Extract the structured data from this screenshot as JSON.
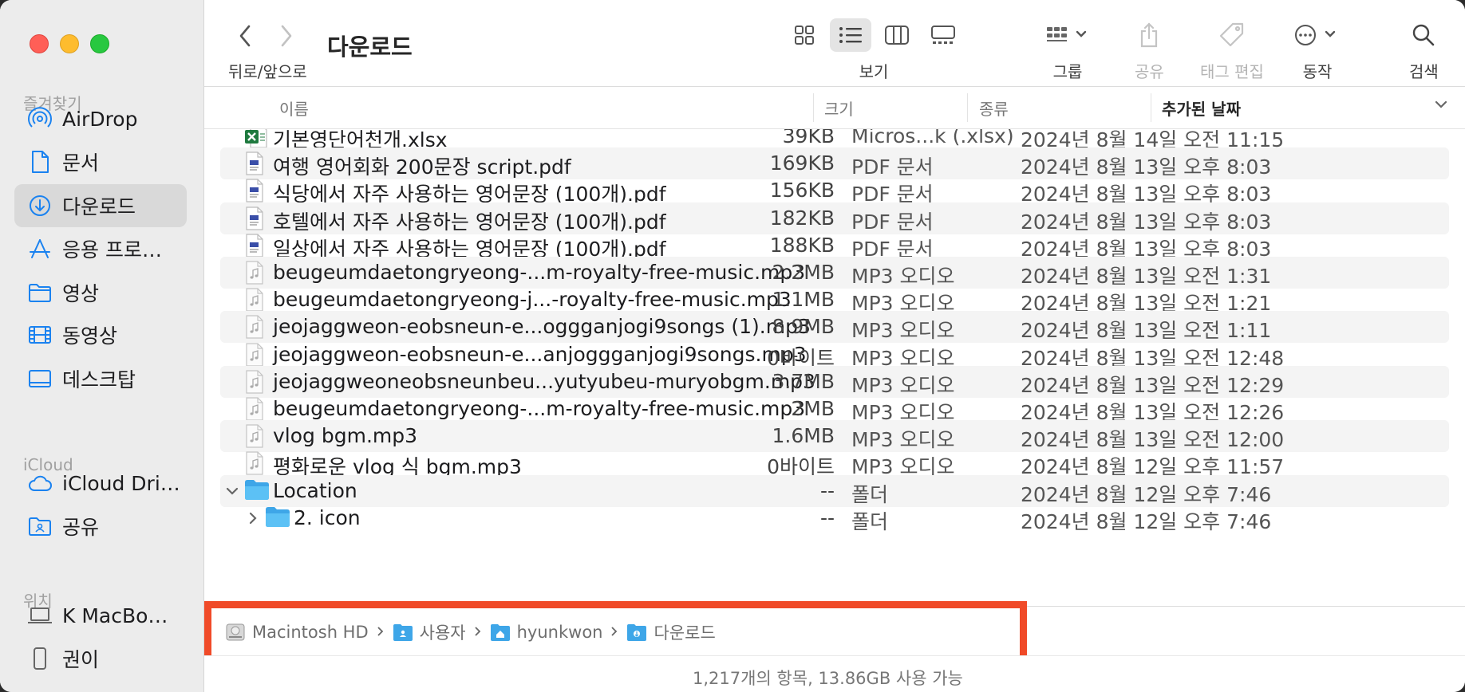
{
  "window": {
    "title": "다운로드"
  },
  "toolbar": {
    "nav_label": "뒤로/앞으로",
    "view_label": "보기",
    "group_label": "그룹",
    "share_label": "공유",
    "tag_label": "태그 편집",
    "action_label": "동작",
    "search_label": "검색"
  },
  "sidebar": {
    "favorites_header": "즐겨찾기",
    "favorites": [
      {
        "label": "AirDrop",
        "icon": "airdrop-icon"
      },
      {
        "label": "문서",
        "icon": "document-icon"
      },
      {
        "label": "다운로드",
        "icon": "download-icon",
        "active": true
      },
      {
        "label": "응용 프로…",
        "icon": "applications-icon"
      },
      {
        "label": "영상",
        "icon": "folder-icon"
      },
      {
        "label": "동영상",
        "icon": "film-icon"
      },
      {
        "label": "데스크탑",
        "icon": "desktop-icon"
      }
    ],
    "icloud_header": "iCloud",
    "icloud": [
      {
        "label": "iCloud Dri…",
        "icon": "cloud-icon"
      },
      {
        "label": "공유",
        "icon": "shared-folder-icon"
      }
    ],
    "locations_header": "위치",
    "locations": [
      {
        "label": "K MacBo…",
        "icon": "laptop-icon"
      },
      {
        "label": "권이",
        "icon": "phone-icon"
      }
    ]
  },
  "columns": {
    "name": "이름",
    "size": "크기",
    "kind": "종류",
    "date_added": "추가된 날짜"
  },
  "files": [
    {
      "name": "기본영단어천개.xlsx",
      "size": "39KB",
      "kind": "Micros...k (.xlsx)",
      "date": "2024년 8월 14일 오전 11:15",
      "type": "xlsx"
    },
    {
      "name": "여행 영어회화 200문장 script.pdf",
      "size": "169KB",
      "kind": "PDF 문서",
      "date": "2024년 8월 13일 오후 8:03",
      "type": "pdf"
    },
    {
      "name": "식당에서 자주 사용하는 영어문장 (100개).pdf",
      "size": "156KB",
      "kind": "PDF 문서",
      "date": "2024년 8월 13일 오후 8:03",
      "type": "pdf"
    },
    {
      "name": "호텔에서 자주 사용하는 영어문장 (100개).pdf",
      "size": "182KB",
      "kind": "PDF 문서",
      "date": "2024년 8월 13일 오후 8:03",
      "type": "pdf"
    },
    {
      "name": "일상에서 자주 사용하는 영어문장 (100개).pdf",
      "size": "188KB",
      "kind": "PDF 문서",
      "date": "2024년 8월 13일 오후 8:03",
      "type": "pdf"
    },
    {
      "name": "beugeumdaetongryeong-...m-royalty-free-music.mp3",
      "size": "2.2MB",
      "kind": "MP3 오디오",
      "date": "2024년 8월 13일 오전 1:31",
      "type": "mp3"
    },
    {
      "name": "beugeumdaetongryeong-j...-royalty-free-music.mp3",
      "size": "1.1MB",
      "kind": "MP3 오디오",
      "date": "2024년 8월 13일 오전 1:21",
      "type": "mp3"
    },
    {
      "name": "jeojaggweon-eobsneun-e...oggganjogi9songs (1).mp3",
      "size": "8.9MB",
      "kind": "MP3 오디오",
      "date": "2024년 8월 13일 오전 1:11",
      "type": "mp3"
    },
    {
      "name": "jeojaggweon-eobsneun-e...anjoggganjogi9songs.mp3",
      "size": "0바이트",
      "kind": "MP3 오디오",
      "date": "2024년 8월 13일 오전 12:48",
      "type": "mp3"
    },
    {
      "name": "jeojaggweoneobsneunbeu...yutyubeu-muryobgm.mp3",
      "size": "3.7MB",
      "kind": "MP3 오디오",
      "date": "2024년 8월 13일 오전 12:29",
      "type": "mp3"
    },
    {
      "name": "beugeumdaetongryeong-...m-royalty-free-music.mp3",
      "size": "2MB",
      "kind": "MP3 오디오",
      "date": "2024년 8월 13일 오전 12:26",
      "type": "mp3"
    },
    {
      "name": "vlog bgm.mp3",
      "size": "1.6MB",
      "kind": "MP3 오디오",
      "date": "2024년 8월 13일 오전 12:00",
      "type": "mp3"
    },
    {
      "name": "평화로운 vlog 식 bgm.mp3",
      "size": "0바이트",
      "kind": "MP3 오디오",
      "date": "2024년 8월 12일 오후 11:57",
      "type": "mp3"
    },
    {
      "name": "Location",
      "size": "--",
      "kind": "폴더",
      "date": "2024년 8월 12일 오후 7:46",
      "type": "folder",
      "expanded": true,
      "depth": 0
    },
    {
      "name": "2. icon",
      "size": "--",
      "kind": "폴더",
      "date": "2024년 8월 12일 오후 7:46",
      "type": "folder",
      "expanded": false,
      "depth": 1
    }
  ],
  "pathbar": [
    {
      "label": "Macintosh HD",
      "icon": "hard-drive-icon"
    },
    {
      "label": "사용자",
      "icon": "users-folder-icon"
    },
    {
      "label": "hyunkwon",
      "icon": "home-folder-icon"
    },
    {
      "label": "다운로드",
      "icon": "downloads-folder-icon"
    }
  ],
  "status": {
    "text": "1,217개의 항목, 13.86GB 사용 가능"
  },
  "colors": {
    "accent": "#0a84ff",
    "folder": "#4fb6f0",
    "highlight": "#f04a28",
    "sidebar_bg": "#ececec"
  }
}
